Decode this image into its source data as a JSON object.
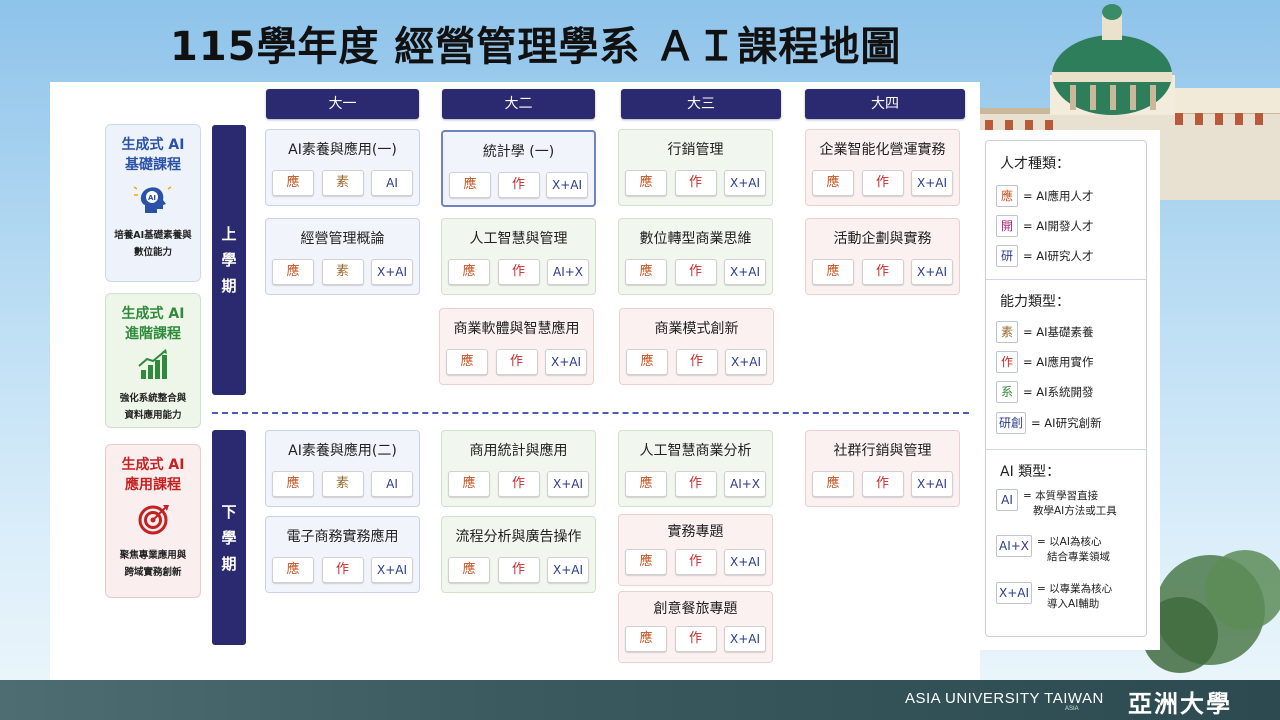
{
  "title": "115學年度 經營管理學系 ＡＩ課程地圖",
  "years": [
    "大一",
    "大二",
    "大三",
    "大四"
  ],
  "semesters": [
    {
      "chars": [
        "上",
        "學",
        "期"
      ]
    },
    {
      "chars": [
        "下",
        "學",
        "期"
      ]
    }
  ],
  "categories": [
    {
      "title_line1": "生成式 AI",
      "title_line2": "基礎課程",
      "icon": "ai-head-icon",
      "desc_line1": "培養AI基礎素養與",
      "desc_line2": "數位能力",
      "color": "#2a52a8"
    },
    {
      "title_line1": "生成式 AI",
      "title_line2": "進階課程",
      "icon": "growth-chart-icon",
      "desc_line1": "強化系統整合與",
      "desc_line2": "資料應用能力",
      "color": "#2f8a3a"
    },
    {
      "title_line1": "生成式 AI",
      "title_line2": "應用課程",
      "icon": "target-icon",
      "desc_line1": "聚焦專業應用與",
      "desc_line2": "跨域實務創新",
      "color": "#c42222"
    }
  ],
  "courses": [
    {
      "name": "AI素養與應用(一)",
      "tags": [
        "應",
        "素",
        "AI"
      ]
    },
    {
      "name": "經營管理概論",
      "tags": [
        "應",
        "素",
        "X+AI"
      ]
    },
    {
      "name": "統計學 (一)",
      "tags": [
        "應",
        "作",
        "X+AI"
      ]
    },
    {
      "name": "人工智慧與管理",
      "tags": [
        "應",
        "作",
        "AI+X"
      ]
    },
    {
      "name": "商業軟體與智慧應用",
      "tags": [
        "應",
        "作",
        "X+AI"
      ]
    },
    {
      "name": "行銷管理",
      "tags": [
        "應",
        "作",
        "X+AI"
      ]
    },
    {
      "name": "數位轉型商業思維",
      "tags": [
        "應",
        "作",
        "X+AI"
      ]
    },
    {
      "name": "商業模式創新",
      "tags": [
        "應",
        "作",
        "X+AI"
      ]
    },
    {
      "name": "企業智能化營運實務",
      "tags": [
        "應",
        "作",
        "X+AI"
      ]
    },
    {
      "name": "活動企劃與實務",
      "tags": [
        "應",
        "作",
        "X+AI"
      ]
    },
    {
      "name": "AI素養與應用(二)",
      "tags": [
        "應",
        "素",
        "AI"
      ]
    },
    {
      "name": "電子商務實務應用",
      "tags": [
        "應",
        "作",
        "X+AI"
      ]
    },
    {
      "name": "商用統計與應用",
      "tags": [
        "應",
        "作",
        "X+AI"
      ]
    },
    {
      "name": "流程分析與廣告操作",
      "tags": [
        "應",
        "作",
        "X+AI"
      ]
    },
    {
      "name": "人工智慧商業分析",
      "tags": [
        "應",
        "作",
        "AI+X"
      ]
    },
    {
      "name": "實務專題",
      "tags": [
        "應",
        "作",
        "X+AI"
      ]
    },
    {
      "name": "創意餐旅專題",
      "tags": [
        "應",
        "作",
        "X+AI"
      ]
    },
    {
      "name": "社群行銷與管理",
      "tags": [
        "應",
        "作",
        "X+AI"
      ]
    }
  ],
  "legend": {
    "talent_title": "人才種類：",
    "talent": [
      {
        "key": "應",
        "text": "= AI應用人才",
        "color": "#c4531f"
      },
      {
        "key": "開",
        "text": "= AI開發人才",
        "color": "#b0237d"
      },
      {
        "key": "研",
        "text": "= AI研究人才",
        "color": "#2a3b8f"
      }
    ],
    "ability_title": "能力類型：",
    "ability": [
      {
        "key": "素",
        "text": "= AI基礎素養",
        "color": "#9a6a2a"
      },
      {
        "key": "作",
        "text": "= AI應用實作",
        "color": "#c62a2a"
      },
      {
        "key": "系",
        "text": "= AI系統開發",
        "color": "#2f8a3a"
      },
      {
        "key": "研創",
        "text": "= AI研究創新",
        "color": "#2a3b8f"
      }
    ],
    "ai_title": "AI 類型：",
    "ai": [
      {
        "key": "AI",
        "line1": "= 本質學習直接",
        "line2": "教學AI方法或工具"
      },
      {
        "key": "AI+X",
        "line1": "= 以AI為核心",
        "line2": "結合專業領域"
      },
      {
        "key": "X+AI",
        "line1": "= 以專業為核心",
        "line2": "導入AI輔助"
      }
    ]
  },
  "footer": {
    "en": "ASIA UNIVERSITY TAIWAN",
    "sub": "ASIA",
    "zh": "亞洲大學"
  }
}
